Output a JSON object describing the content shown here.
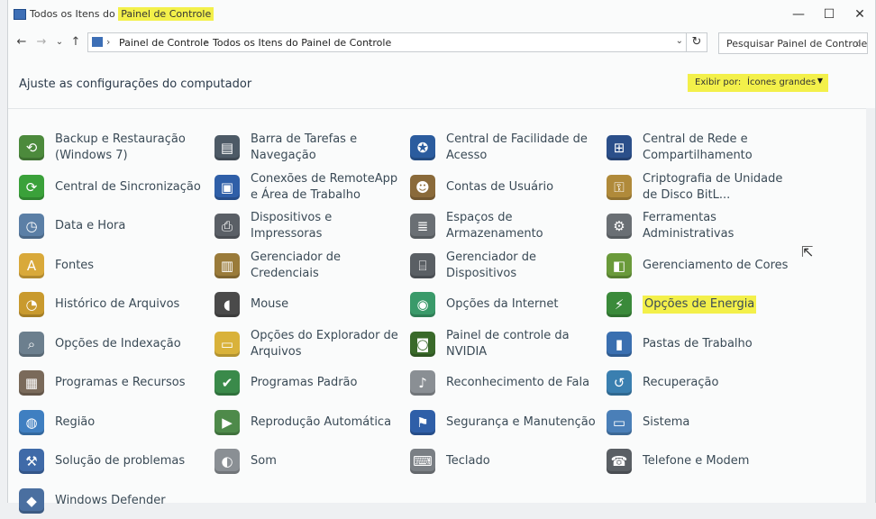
{
  "window": {
    "title_prefix": "Todos os Itens do ",
    "title_highlight": "Painel de Controle",
    "controls": {
      "minimize": "—",
      "maximize": "☐",
      "close": "✕"
    }
  },
  "nav": {
    "back": "←",
    "forward": "→",
    "recent": "⌄",
    "up": "↑",
    "breadcrumb": [
      "Painel de Controle",
      "Todos os Itens do Painel de Controle"
    ],
    "separator": "›",
    "dropdown": "⌄",
    "refresh": "↻",
    "search_placeholder": "Pesquisar Painel de Controle",
    "search_icon": "⌕"
  },
  "header": {
    "title": "Ajuste as configurações do computador",
    "view_by_label": "Exibir por:",
    "view_by_value": "Ícones grandes",
    "view_by_arrow": "▼"
  },
  "colors": {
    "highlight": "#f3f04a",
    "label": "#3a4a56",
    "accent": "#3d6fb6"
  },
  "columns": [
    [
      {
        "label": "Backup e Restauração (Windows 7)",
        "icon": "backup-icon",
        "glyph": "⟲",
        "color": "#4c8a3c"
      },
      {
        "label": "Central de Sincronização",
        "icon": "sync-center-icon",
        "glyph": "⟳",
        "color": "#3aa13a"
      },
      {
        "label": "Data e Hora",
        "icon": "calendar-clock-icon",
        "glyph": "◷",
        "color": "#5b7fa6"
      },
      {
        "label": "Fontes",
        "icon": "fonts-folder-icon",
        "glyph": "A",
        "color": "#d9a93a"
      },
      {
        "label": "Histórico de Arquivos",
        "icon": "file-history-icon",
        "glyph": "◔",
        "color": "#c99a2e"
      },
      {
        "label": "Opções de Indexação",
        "icon": "indexing-icon",
        "glyph": "⌕",
        "color": "#6c7f8e"
      },
      {
        "label": "Programas e Recursos",
        "icon": "programs-features-icon",
        "glyph": "▦",
        "color": "#7a6a5a"
      },
      {
        "label": "Região",
        "icon": "globe-clock-icon",
        "glyph": "◍",
        "color": "#3f7fc1"
      },
      {
        "label": "Solução de problemas",
        "icon": "troubleshoot-icon",
        "glyph": "⚒",
        "color": "#3f6aa8"
      },
      {
        "label": "Windows Defender",
        "icon": "defender-icon",
        "glyph": "◆",
        "color": "#4a6fa0"
      }
    ],
    [
      {
        "label": "Barra de Tarefas e Navegação",
        "icon": "taskbar-icon",
        "glyph": "▤",
        "color": "#4d5a66"
      },
      {
        "label": "Conexões de RemoteApp e Área de Trabalho",
        "icon": "remoteapp-icon",
        "glyph": "▣",
        "color": "#2f5fa8"
      },
      {
        "label": "Dispositivos e Impressoras",
        "icon": "devices-printers-icon",
        "glyph": "⎙",
        "color": "#5a5f66"
      },
      {
        "label": "Gerenciador de Credenciais",
        "icon": "credential-vault-icon",
        "glyph": "▥",
        "color": "#9a7b3a"
      },
      {
        "label": "Mouse",
        "icon": "mouse-icon",
        "glyph": "◖",
        "color": "#4a4a4a"
      },
      {
        "label": "Opções do Explorador de Arquivos",
        "icon": "folder-options-icon",
        "glyph": "▭",
        "color": "#d9b23a"
      },
      {
        "label": "Programas Padrão",
        "icon": "default-programs-icon",
        "glyph": "✔",
        "color": "#3a8a4a"
      },
      {
        "label": "Reprodução Automática",
        "icon": "autoplay-icon",
        "glyph": "▶",
        "color": "#4e8a4a"
      },
      {
        "label": "Som",
        "icon": "speaker-icon",
        "glyph": "◐",
        "color": "#8a8f94"
      }
    ],
    [
      {
        "label": "Central de Facilidade de Acesso",
        "icon": "ease-of-access-icon",
        "glyph": "✪",
        "color": "#2b5c9e"
      },
      {
        "label": "Contas de Usuário",
        "icon": "user-accounts-icon",
        "glyph": "☻",
        "color": "#8a6a3a"
      },
      {
        "label": "Espaços de Armazenamento",
        "icon": "storage-spaces-icon",
        "glyph": "≣",
        "color": "#6a6f74"
      },
      {
        "label": "Gerenciador de Dispositivos",
        "icon": "device-manager-icon",
        "glyph": "⌸",
        "color": "#5a5f64"
      },
      {
        "label": "Opções da Internet",
        "icon": "internet-options-icon",
        "glyph": "◉",
        "color": "#3a9a6a"
      },
      {
        "label": "Painel de controle da NVIDIA",
        "icon": "nvidia-icon",
        "glyph": "◙",
        "color": "#3a6a2a"
      },
      {
        "label": "Reconhecimento de Fala",
        "icon": "microphone-icon",
        "glyph": "♪",
        "color": "#8a8f94"
      },
      {
        "label": "Segurança e Manutenção",
        "icon": "security-flag-icon",
        "glyph": "⚑",
        "color": "#2f5fa8"
      },
      {
        "label": "Teclado",
        "icon": "keyboard-icon",
        "glyph": "⌨",
        "color": "#7a7f84"
      }
    ],
    [
      {
        "label": "Central de Rede e Compartilhamento",
        "icon": "network-center-icon",
        "glyph": "⊞",
        "color": "#2b4f8a"
      },
      {
        "label": "Criptografia de Unidade de Disco BitL...",
        "icon": "bitlocker-icon",
        "glyph": "⚿",
        "color": "#b08a3a"
      },
      {
        "label": "Ferramentas Administrativas",
        "icon": "admin-tools-icon",
        "glyph": "⚙",
        "color": "#6a6f74"
      },
      {
        "label": "Gerenciamento de Cores",
        "icon": "color-management-icon",
        "glyph": "◧",
        "color": "#6a9a3a"
      },
      {
        "label": "Opções de Energia",
        "icon": "power-options-icon",
        "glyph": "⚡",
        "color": "#3a8a3a",
        "highlight": true
      },
      {
        "label": "Pastas de Trabalho",
        "icon": "work-folders-icon",
        "glyph": "▮",
        "color": "#3a6fb0"
      },
      {
        "label": "Recuperação",
        "icon": "recovery-icon",
        "glyph": "↺",
        "color": "#3a7fb0"
      },
      {
        "label": "Sistema",
        "icon": "system-icon",
        "glyph": "▭",
        "color": "#4a7fb8"
      },
      {
        "label": "Telefone e Modem",
        "icon": "phone-modem-icon",
        "glyph": "☎",
        "color": "#5a5f64"
      }
    ]
  ]
}
